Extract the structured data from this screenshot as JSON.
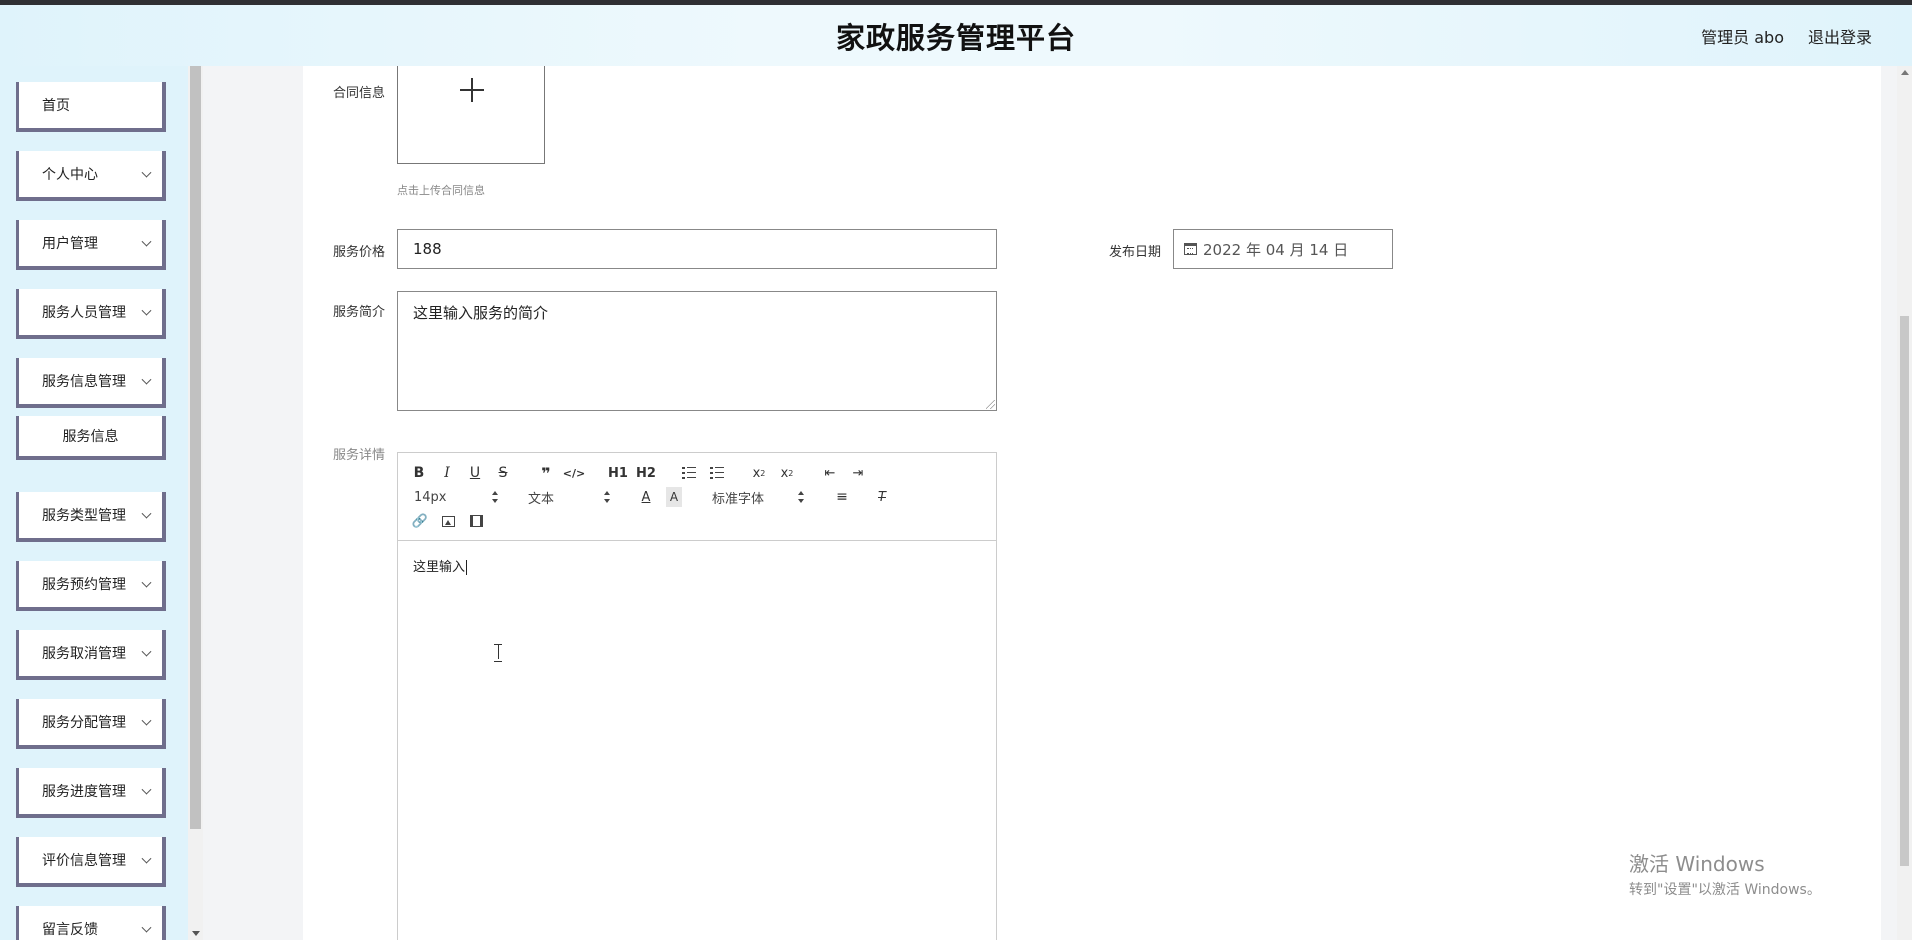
{
  "header": {
    "title": "家政服务管理平台",
    "admin_label": "管理员 abo",
    "logout_label": "退出登录"
  },
  "sidebar": {
    "items": [
      {
        "label": "首页",
        "has_chevron": false
      },
      {
        "label": "个人中心",
        "has_chevron": true
      },
      {
        "label": "用户管理",
        "has_chevron": true
      },
      {
        "label": "服务人员管理",
        "has_chevron": true
      },
      {
        "label": "服务信息管理",
        "has_chevron": true
      },
      {
        "label": "服务信息",
        "has_chevron": false,
        "sub": true
      },
      {
        "label": "服务类型管理",
        "has_chevron": true
      },
      {
        "label": "服务预约管理",
        "has_chevron": true
      },
      {
        "label": "服务取消管理",
        "has_chevron": true
      },
      {
        "label": "服务分配管理",
        "has_chevron": true
      },
      {
        "label": "服务进度管理",
        "has_chevron": true
      },
      {
        "label": "评价信息管理",
        "has_chevron": true
      },
      {
        "label": "留言反馈",
        "has_chevron": true
      }
    ]
  },
  "form": {
    "contract_label": "合同信息",
    "contract_hint": "点击上传合同信息",
    "price_label": "服务价格",
    "price_value": "188",
    "date_label": "发布日期",
    "date_value": "2022 年 04 月 14 日",
    "intro_label": "服务简介",
    "intro_value": "这里输入服务的简介",
    "detail_label": "服务详情"
  },
  "editor": {
    "toolbar_row1": [
      "B",
      "I",
      "U",
      "S"
    ],
    "heading1": "H1",
    "heading2": "H2",
    "font_size": "14px",
    "text_type": "文本",
    "font_family": "标准字体",
    "content": "这里输入"
  },
  "watermark": {
    "line1": "激活 Windows",
    "line2": "转到\"设置\"以激活 Windows。"
  }
}
